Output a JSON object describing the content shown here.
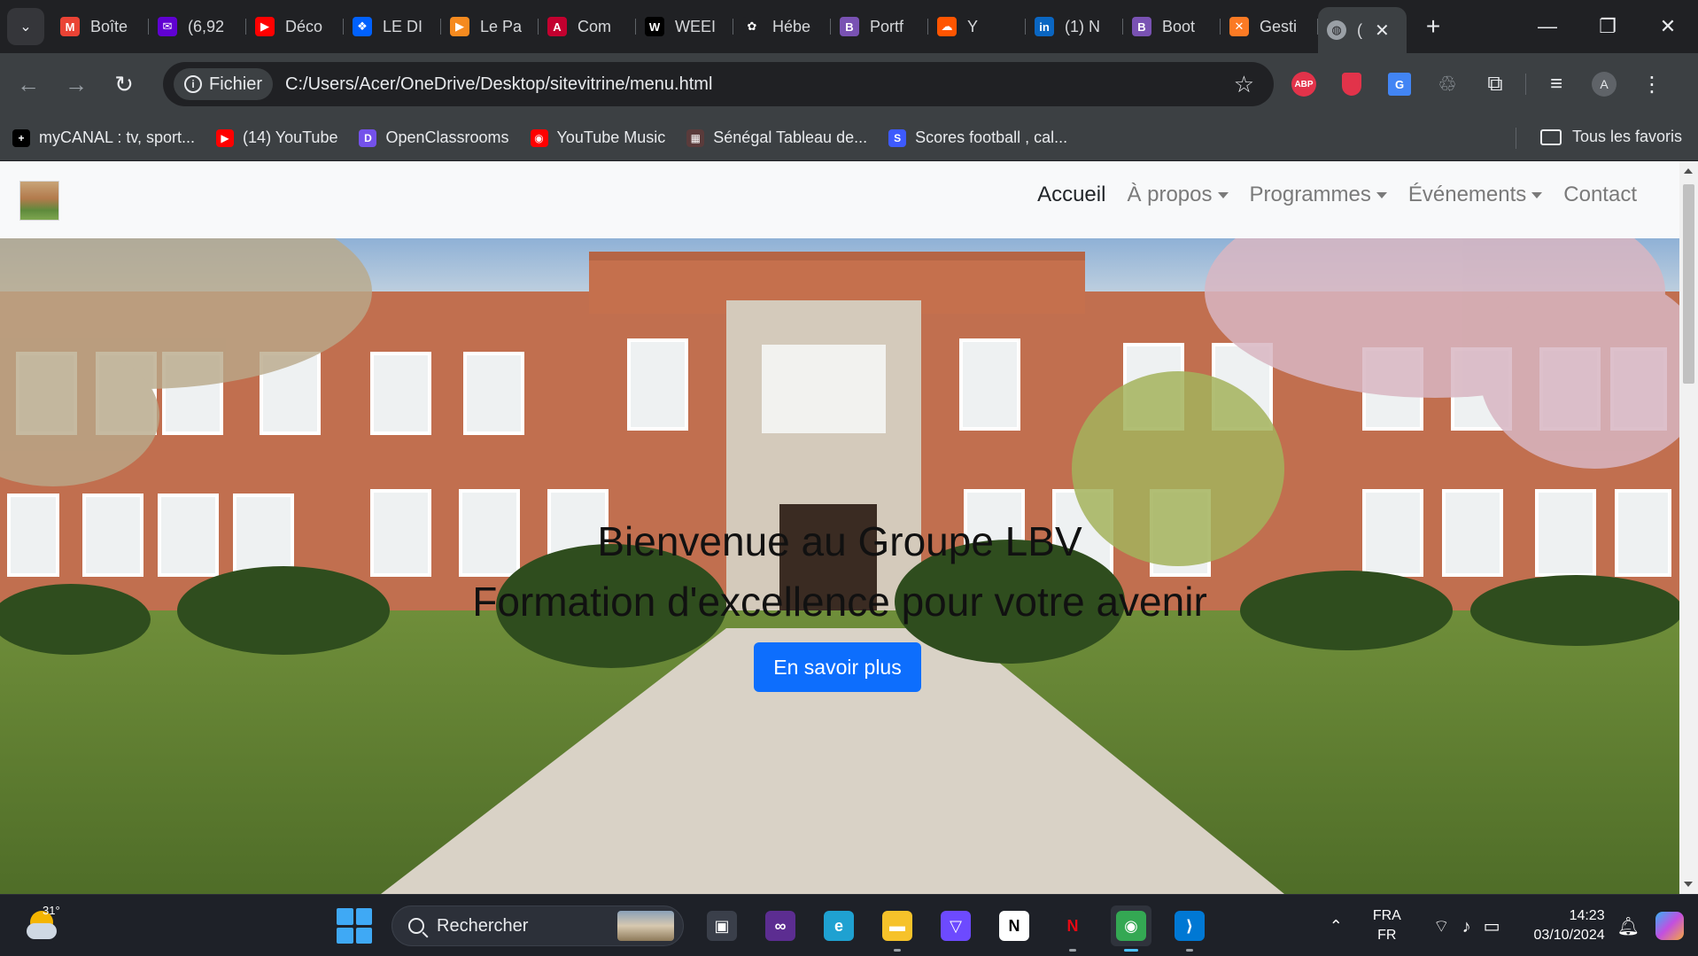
{
  "tabs": [
    {
      "title": "Boîte",
      "icon": "gmail-icon",
      "color": "#ea4335",
      "glyph": "M"
    },
    {
      "title": "(6,92",
      "icon": "yahoo-mail-icon",
      "color": "#6001d2",
      "glyph": "✉"
    },
    {
      "title": "Déco",
      "icon": "youtube-icon",
      "color": "#ff0000",
      "glyph": "▶"
    },
    {
      "title": "LE DI",
      "icon": "dropbox-icon",
      "color": "#0061fe",
      "glyph": "❖"
    },
    {
      "title": "Le Pa",
      "icon": "play-icon",
      "color": "#f58a1f",
      "glyph": "▶"
    },
    {
      "title": "Com",
      "icon": "angular-icon",
      "color": "#c3002f",
      "glyph": "A"
    },
    {
      "title": "WEEI",
      "icon": "wikipedia-icon",
      "color": "#000000",
      "glyph": "W"
    },
    {
      "title": "Hébe",
      "icon": "openai-icon",
      "color": "#202124",
      "glyph": "✿"
    },
    {
      "title": "Portf",
      "icon": "bootstrap-icon",
      "color": "#7952b3",
      "glyph": "B"
    },
    {
      "title": "Y",
      "icon": "soundcloud-icon",
      "color": "#ff5500",
      "glyph": "☁"
    },
    {
      "title": "(1) N",
      "icon": "linkedin-icon",
      "color": "#0a66c2",
      "glyph": "in"
    },
    {
      "title": "Boot",
      "icon": "bootstrap-icon",
      "color": "#7952b3",
      "glyph": "B"
    },
    {
      "title": "Gesti",
      "icon": "xampp-icon",
      "color": "#fb7a24",
      "glyph": "✕"
    }
  ],
  "active_tab": {
    "title": "(",
    "icon": "globe-icon"
  },
  "toolbar": {
    "scheme_label": "Fichier",
    "url": "C:/Users/Acer/OneDrive/Desktop/sitevitrine/menu.html",
    "abp_label": "ABP",
    "translate_label": "G",
    "profile_initial": "A"
  },
  "bookmarks": [
    {
      "label": "myCANAL : tv, sport...",
      "icon": "mycanal-icon",
      "color": "#000000",
      "glyph": "+"
    },
    {
      "label": "(14) YouTube",
      "icon": "youtube-icon",
      "color": "#ff0000",
      "glyph": "▶"
    },
    {
      "label": "OpenClassrooms",
      "icon": "openclassrooms-icon",
      "color": "#7451eb",
      "glyph": "D"
    },
    {
      "label": "YouTube Music",
      "icon": "youtube-music-icon",
      "color": "#ff0000",
      "glyph": "◉"
    },
    {
      "label": "Sénégal Tableau de...",
      "icon": "scoreboard-icon",
      "color": "#5a3b3b",
      "glyph": "▦"
    },
    {
      "label": "Scores football , cal...",
      "icon": "scores-icon",
      "color": "#3d5afe",
      "glyph": "S"
    }
  ],
  "all_bookmarks_label": "Tous les favoris",
  "site": {
    "nav": [
      {
        "label": "Accueil",
        "active": true,
        "dropdown": false
      },
      {
        "label": "À propos",
        "active": false,
        "dropdown": true
      },
      {
        "label": "Programmes",
        "active": false,
        "dropdown": true
      },
      {
        "label": "Événements",
        "active": false,
        "dropdown": true
      },
      {
        "label": "Contact",
        "active": false,
        "dropdown": false
      }
    ],
    "hero_title": "Bienvenue au Groupe LBV",
    "hero_subtitle": "Formation d'excellence pour votre avenir",
    "hero_button": "En savoir plus",
    "primary_color": "#0d6efd"
  },
  "taskbar": {
    "temperature": "31°",
    "search_placeholder": "Rechercher",
    "apps": [
      "task-view-icon",
      "visual-studio-icon",
      "edge-icon",
      "file-explorer-icon",
      "proton-vpn-icon",
      "notion-icon",
      "netflix-icon",
      "chrome-icon",
      "vscode-icon"
    ],
    "lang_top": "FRA",
    "lang_bottom": "FR",
    "time": "14:23",
    "date": "03/10/2024"
  }
}
